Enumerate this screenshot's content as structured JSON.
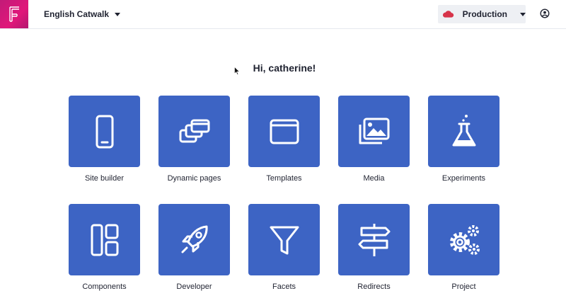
{
  "header": {
    "site_name": "English Catwalk",
    "environment": "Production"
  },
  "greeting": "Hi, catherine!",
  "tiles": [
    {
      "label": "Site builder",
      "icon": "phone-icon"
    },
    {
      "label": "Dynamic pages",
      "icon": "stacked-windows-icon"
    },
    {
      "label": "Templates",
      "icon": "window-icon"
    },
    {
      "label": "Media",
      "icon": "images-icon"
    },
    {
      "label": "Experiments",
      "icon": "flask-icon"
    },
    {
      "label": "Components",
      "icon": "layout-icon"
    },
    {
      "label": "Developer",
      "icon": "rocket-icon"
    },
    {
      "label": "Facets",
      "icon": "funnel-icon"
    },
    {
      "label": "Redirects",
      "icon": "signpost-icon"
    },
    {
      "label": "Project",
      "icon": "gears-icon"
    }
  ],
  "colors": {
    "brand": "#e0177a",
    "tile": "#3d64c4",
    "environment_cloud": "#d7344a"
  }
}
